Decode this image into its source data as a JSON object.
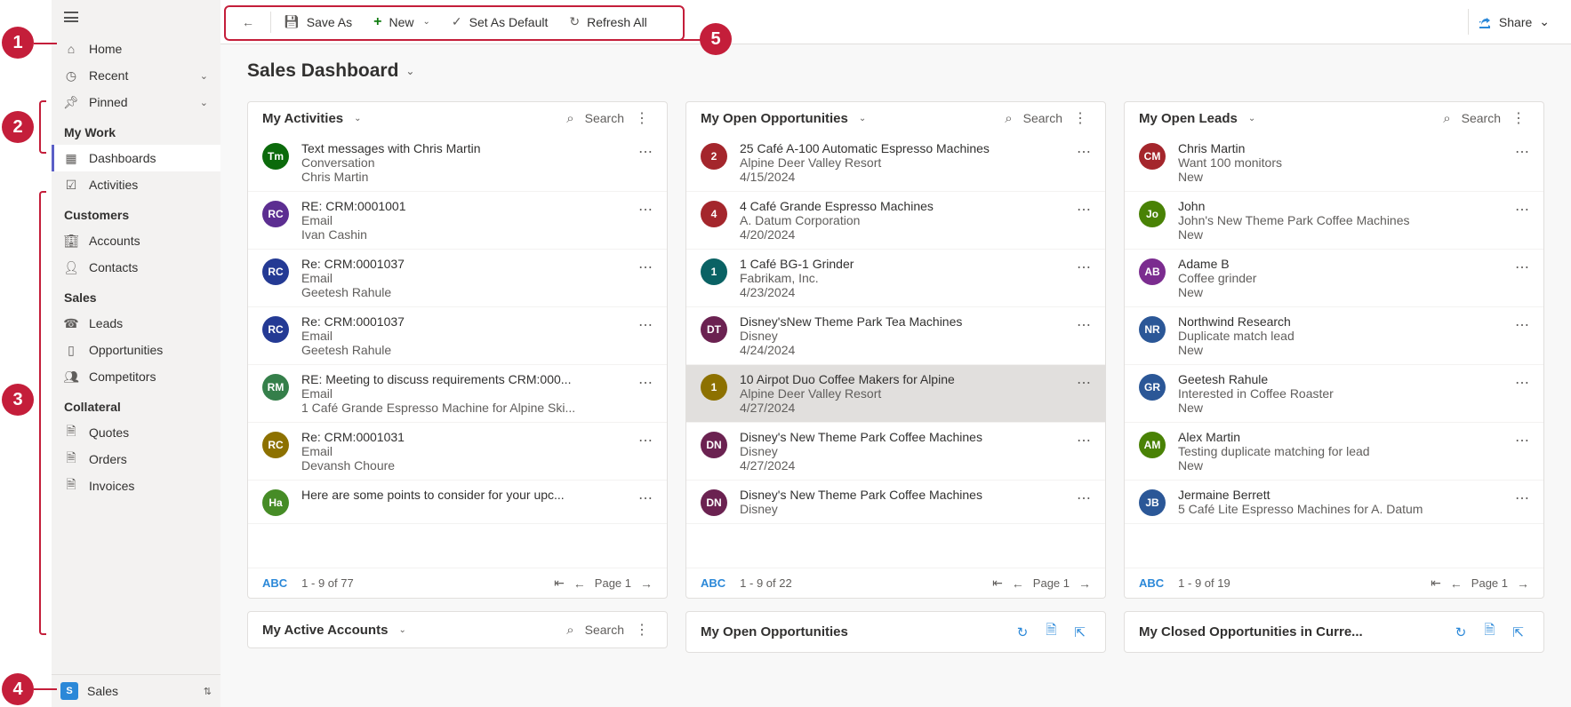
{
  "annotations": {
    "a1": "1",
    "a2": "2",
    "a3": "3",
    "a4": "4",
    "a5": "5"
  },
  "sidebar": {
    "home": "Home",
    "recent": "Recent",
    "pinned": "Pinned",
    "groups": {
      "mywork": {
        "label": "My Work",
        "items": [
          "Dashboards",
          "Activities"
        ]
      },
      "customers": {
        "label": "Customers",
        "items": [
          "Accounts",
          "Contacts"
        ]
      },
      "sales": {
        "label": "Sales",
        "items": [
          "Leads",
          "Opportunities",
          "Competitors"
        ]
      },
      "collateral": {
        "label": "Collateral",
        "items": [
          "Quotes",
          "Orders",
          "Invoices"
        ]
      }
    },
    "footer": {
      "badge": "S",
      "label": "Sales"
    }
  },
  "cmdbar": {
    "saveas": "Save As",
    "new": "New",
    "setdefault": "Set As Default",
    "refreshall": "Refresh All",
    "share": "Share"
  },
  "page": {
    "title": "Sales Dashboard"
  },
  "search_label": "Search",
  "cards": {
    "activities": {
      "title": "My Activities",
      "footer": {
        "abc": "ABC",
        "count": "1 - 9 of 77",
        "page": "Page 1"
      },
      "rows": [
        {
          "av": "Tm",
          "bg": "#0b6a0b",
          "l1": "Text messages with Chris Martin",
          "l2": "Conversation",
          "l3": "Chris Martin"
        },
        {
          "av": "RC",
          "bg": "#5c2e91",
          "l1": "RE: CRM:0001001",
          "l2": "Email",
          "l3": "Ivan Cashin"
        },
        {
          "av": "RC",
          "bg": "#243a94",
          "l1": "Re: CRM:0001037",
          "l2": "Email",
          "l3": "Geetesh Rahule"
        },
        {
          "av": "RC",
          "bg": "#243a94",
          "l1": "Re: CRM:0001037",
          "l2": "Email",
          "l3": "Geetesh Rahule"
        },
        {
          "av": "RM",
          "bg": "#357f4a",
          "l1": "RE: Meeting to discuss requirements CRM:000...",
          "l2": "Email",
          "l3": "1 Café Grande Espresso Machine for Alpine Ski..."
        },
        {
          "av": "RC",
          "bg": "#8d7100",
          "l1": "Re: CRM:0001031",
          "l2": "Email",
          "l3": "Devansh Choure"
        },
        {
          "av": "Ha",
          "bg": "#468c26",
          "l1": "Here are some points to consider for your upc...",
          "l2": "",
          "l3": ""
        }
      ]
    },
    "opportunities": {
      "title": "My Open Opportunities",
      "footer": {
        "abc": "ABC",
        "count": "1 - 9 of 22",
        "page": "Page 1"
      },
      "rows": [
        {
          "av": "2",
          "bg": "#a4262c",
          "l1": "25 Café A-100 Automatic Espresso Machines",
          "l2": "Alpine Deer Valley Resort",
          "l3": "4/15/2024"
        },
        {
          "av": "4",
          "bg": "#a4262c",
          "l1": "4 Café Grande Espresso Machines",
          "l2": "A. Datum Corporation",
          "l3": "4/20/2024"
        },
        {
          "av": "1",
          "bg": "#0a6264",
          "l1": "1 Café BG-1 Grinder",
          "l2": "Fabrikam, Inc.",
          "l3": "4/23/2024"
        },
        {
          "av": "DT",
          "bg": "#6b2251",
          "l1": "Disney'sNew Theme Park Tea Machines",
          "l2": "Disney",
          "l3": "4/24/2024"
        },
        {
          "av": "1",
          "bg": "#8d7100",
          "l1": "10 Airpot Duo Coffee Makers for Alpine",
          "l2": "Alpine Deer Valley Resort",
          "l3": "4/27/2024",
          "selected": true
        },
        {
          "av": "DN",
          "bg": "#6b2251",
          "l1": "Disney's New Theme Park Coffee Machines",
          "l2": "Disney",
          "l3": "4/27/2024"
        },
        {
          "av": "DN",
          "bg": "#6b2251",
          "l1": "Disney's New Theme Park Coffee Machines",
          "l2": "Disney",
          "l3": ""
        }
      ]
    },
    "leads": {
      "title": "My Open Leads",
      "footer": {
        "abc": "ABC",
        "count": "1 - 9 of 19",
        "page": "Page 1"
      },
      "rows": [
        {
          "av": "CM",
          "bg": "#a4262c",
          "l1": "Chris Martin",
          "l2": "Want 100 monitors",
          "l3": "New"
        },
        {
          "av": "Jo",
          "bg": "#498205",
          "l1": "John",
          "l2": "John's New Theme Park Coffee Machines",
          "l3": "New"
        },
        {
          "av": "AB",
          "bg": "#7b2c8f",
          "l1": "Adame B",
          "l2": "Coffee grinder",
          "l3": "New"
        },
        {
          "av": "NR",
          "bg": "#2b5797",
          "l1": "Northwind Research",
          "l2": "Duplicate match lead",
          "l3": "New"
        },
        {
          "av": "GR",
          "bg": "#2b5797",
          "l1": "Geetesh Rahule",
          "l2": "Interested in Coffee Roaster",
          "l3": "New"
        },
        {
          "av": "AM",
          "bg": "#498205",
          "l1": "Alex Martin",
          "l2": "Testing duplicate matching for lead",
          "l3": "New"
        },
        {
          "av": "JB",
          "bg": "#2b5797",
          "l1": "Jermaine Berrett",
          "l2": "5 Café Lite Espresso Machines for A. Datum",
          "l3": ""
        }
      ]
    }
  },
  "footer_cards": {
    "a": {
      "title": "My Active Accounts"
    },
    "b": {
      "title": "My Open Opportunities"
    },
    "c": {
      "title": "My Closed Opportunities in Curre..."
    }
  }
}
